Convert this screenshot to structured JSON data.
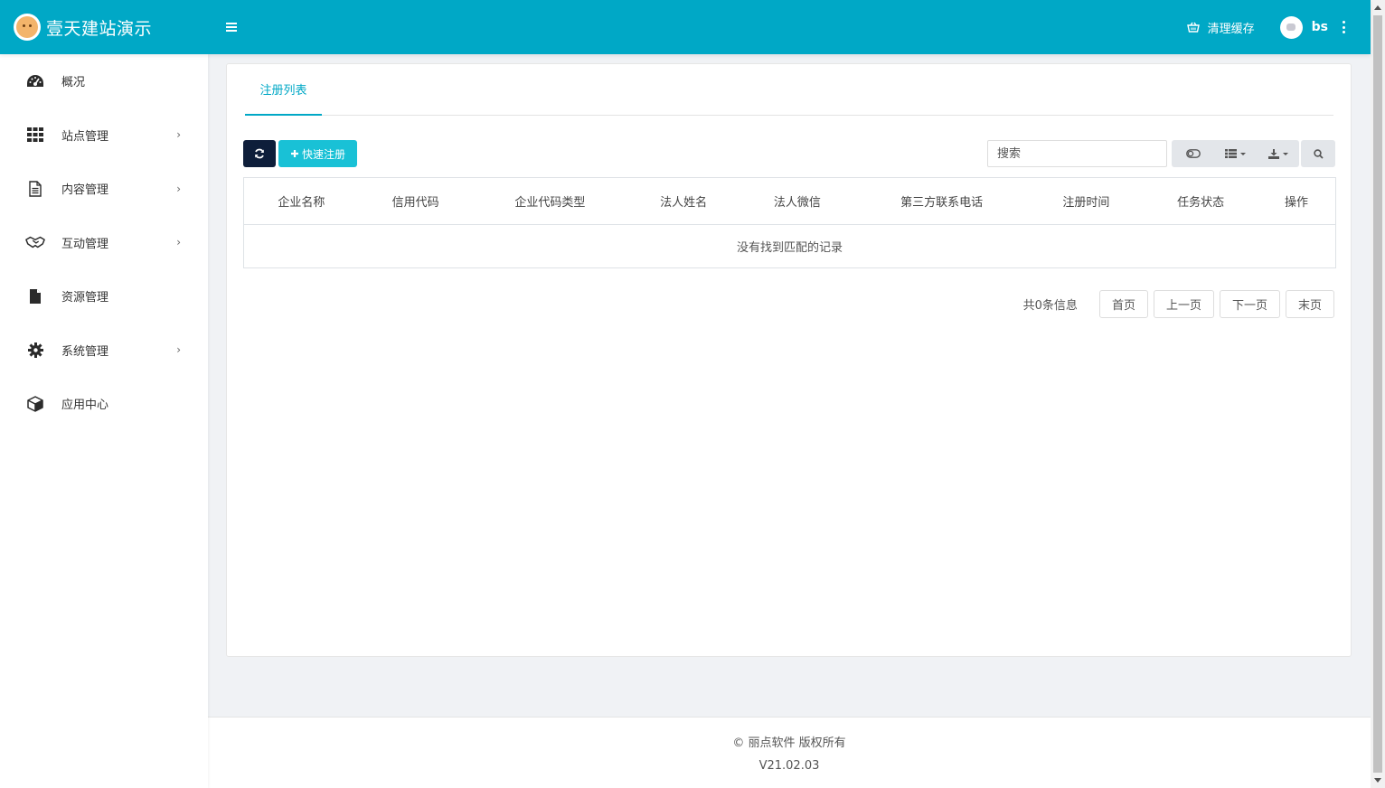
{
  "header": {
    "brand_title": "壹天建站演示",
    "clear_cache_label": "清理缓存",
    "user_name": "bs"
  },
  "sidebar": {
    "items": [
      {
        "label": "概况",
        "icon": "dashboard-icon",
        "has_submenu": false
      },
      {
        "label": "站点管理",
        "icon": "grid-icon",
        "has_submenu": true
      },
      {
        "label": "内容管理",
        "icon": "document-icon",
        "has_submenu": true
      },
      {
        "label": "互动管理",
        "icon": "handshake-icon",
        "has_submenu": true
      },
      {
        "label": "资源管理",
        "icon": "file-icon",
        "has_submenu": false
      },
      {
        "label": "系统管理",
        "icon": "gear-icon",
        "has_submenu": true
      },
      {
        "label": "应用中心",
        "icon": "cube-icon",
        "has_submenu": false
      }
    ]
  },
  "main": {
    "tab_label": "注册列表",
    "toolbar": {
      "quick_register_label": "快速注册",
      "search_placeholder": "搜索"
    },
    "table": {
      "columns": [
        "企业名称",
        "信用代码",
        "企业代码类型",
        "法人姓名",
        "法人微信",
        "第三方联系电话",
        "注册时间",
        "任务状态",
        "操作"
      ],
      "empty_message": "没有找到匹配的记录"
    },
    "pagination": {
      "info": "共0条信息",
      "first": "首页",
      "prev": "上一页",
      "next": "下一页",
      "last": "末页"
    }
  },
  "footer": {
    "copyright": "© 丽点软件 版权所有",
    "version": "V21.02.03"
  },
  "colors": {
    "accent": "#00a8c6",
    "quick_button": "#19c1d6",
    "refresh_button": "#0e1e3a"
  }
}
